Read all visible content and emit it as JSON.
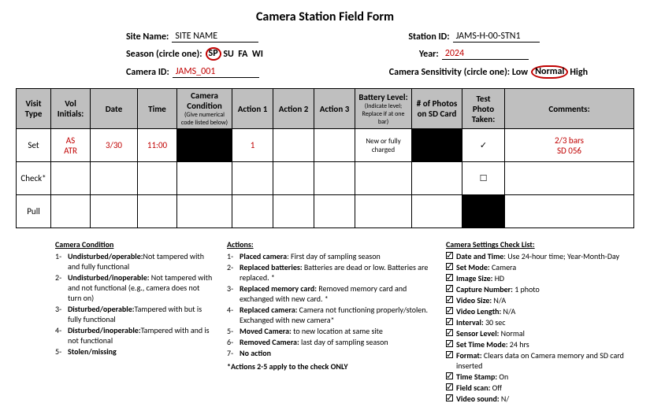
{
  "title": "Camera Station Field Form",
  "labels": {
    "site_name": "Site Name:",
    "station_id": "Station ID:",
    "season": "Season (circle one):",
    "year": "Year:",
    "camera_id": "Camera ID:",
    "sensitivity": "Camera Sensitivity (circle one): Low",
    "sensitivity_after": "High"
  },
  "header": {
    "site_name": "SITE NAME",
    "station_id": "JAMS-H-00-STN1",
    "seasons": {
      "sp": "SP",
      "su": "SU",
      "fa": "FA",
      "wi": "WI"
    },
    "year": "2024",
    "camera_id": "JAMS_001",
    "sensitivity_sel": "Normal"
  },
  "thead": {
    "visit": "Visit Type",
    "initials": "Vol Initials:",
    "date": "Date",
    "time": "Time",
    "cond": "Camera Condition",
    "cond_sub": "(Give numerical code listed below)",
    "a1": "Action 1",
    "a2": "Action 2",
    "a3": "Action 3",
    "batt": "Battery Level:",
    "batt_sub": "(Indicate level; Replace if at one bar)",
    "photos": "# of Photos on SD Card",
    "test": "Test Photo Taken:",
    "comments": "Comments:"
  },
  "rows": {
    "set": {
      "label": "Set",
      "initials": "AS\nATR",
      "date": "3/30",
      "time": "11:00",
      "a1": "1",
      "batt": "New or fully charged",
      "test": "✓",
      "comments": "2/3 bars\nSD 056"
    },
    "check": {
      "label": "Check*",
      "test": "☐"
    },
    "pull": {
      "label": "Pull"
    }
  },
  "cond": {
    "heading": "Camera Condition",
    "items": [
      {
        "b": "Undisturbed/operable:",
        "t": "Not tampered with and fully functional"
      },
      {
        "b": "Undisturbed/inoperable:",
        "t": " Not tampered with and not functional  (e.g., camera does not turn on)"
      },
      {
        "b": "Disturbed/operable:",
        "t": "Tampered  with but is fully functional"
      },
      {
        "b": "Disturbed/inoperable:",
        "t": "Tampered  with and is not functional"
      },
      {
        "b": "Stolen/missing",
        "t": ""
      }
    ]
  },
  "actions": {
    "heading": "Actions:",
    "items": [
      {
        "b": "Placed camera",
        "t": ": First day of sampling season"
      },
      {
        "b": "Replaced batteries:",
        "t": " Batteries are dead or low. Batteries are replaced. *"
      },
      {
        "b": "Replaced memory card:",
        "t": " Removed memory card and exchanged with new card. *"
      },
      {
        "b": "Replaced camera:",
        "t": " Camera not functioning properly/stolen. Exchanged with new camera*"
      },
      {
        "b": "Moved Camera:",
        "t": " to new location at same site"
      },
      {
        "b": "Removed Camera:",
        "t": " last day of sampling season"
      },
      {
        "b": "No action",
        "t": ""
      }
    ],
    "note": "*Actions 2-5 apply to the check ONLY"
  },
  "settings": {
    "heading": "Camera Settings Check List:",
    "items": [
      {
        "b": "Date and Time",
        "t": ": Use 24-hour time; Year-Month-Day"
      },
      {
        "b": "Set Mode:",
        "t": " Camera"
      },
      {
        "b": "Image Size:",
        "t": " HD"
      },
      {
        "b": "Capture Number:",
        "t": " 1 photo"
      },
      {
        "b": "Video Size:",
        "t": " N/A"
      },
      {
        "b": "Video Length:",
        "t": " N/A"
      },
      {
        "b": "Interval:",
        "t": " 30 sec"
      },
      {
        "b": "Sensor Level:",
        "t": " Normal"
      },
      {
        "b": "Set Time Mode:",
        "t": " 24 hrs"
      },
      {
        "b": "Format:",
        "t": " Clears data on Camera memory and SD card inserted"
      },
      {
        "b": "Time Stamp:",
        "t": " On"
      },
      {
        "b": "Field scan:",
        "t": " Off"
      },
      {
        "b": "Video sound:",
        "t": " N/"
      }
    ]
  }
}
